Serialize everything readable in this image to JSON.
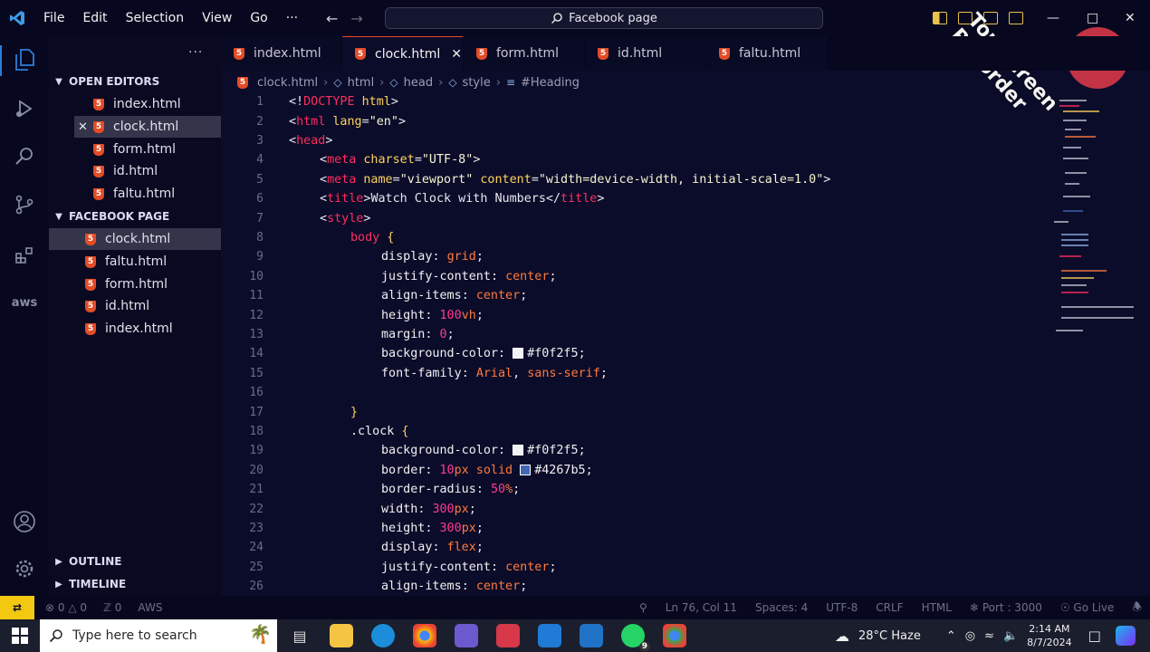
{
  "titlebar": {
    "menu": [
      "File",
      "Edit",
      "Selection",
      "View",
      "Go",
      "···"
    ],
    "search_text": "Facebook page"
  },
  "watermark": {
    "text": "Top Screen Recorder"
  },
  "sidebar": {
    "more": "···",
    "open_editors_header": "OPEN EDITORS",
    "open_editors": [
      "index.html",
      "clock.html",
      "form.html",
      "id.html",
      "faltu.html"
    ],
    "folder_header": "FACEBOOK PAGE",
    "folder_files": [
      "clock.html",
      "faltu.html",
      "form.html",
      "id.html",
      "index.html"
    ],
    "outline_header": "OUTLINE",
    "timeline_header": "TIMELINE"
  },
  "tabs": [
    {
      "label": "index.html",
      "active": false
    },
    {
      "label": "clock.html",
      "active": true
    },
    {
      "label": "form.html",
      "active": false
    },
    {
      "label": "id.html",
      "active": false
    },
    {
      "label": "faltu.html",
      "active": false
    }
  ],
  "breadcrumb": [
    "clock.html",
    "html",
    "head",
    "style",
    "#Heading"
  ],
  "editor": {
    "line_numbers": [
      "1",
      "2",
      "3",
      "4",
      "5",
      "6",
      "7",
      "8",
      "9",
      "10",
      "11",
      "12",
      "13",
      "14",
      "15",
      "16",
      "17",
      "18",
      "19",
      "20",
      "21",
      "22",
      "23",
      "24",
      "25",
      "26"
    ],
    "l1": {
      "a": "<!",
      "b": "DOCTYPE",
      "c": " html",
      "d": ">"
    },
    "l2": {
      "a": "<",
      "b": "html",
      "c": " lang",
      "d": "=",
      "e": "\"en\"",
      "f": ">"
    },
    "l3": {
      "a": "<",
      "b": "head",
      "c": ">"
    },
    "l4": {
      "a": "<",
      "b": "meta",
      "c": " charset",
      "d": "=",
      "e": "\"UTF-8\"",
      "f": ">"
    },
    "l5": {
      "a": "<",
      "b": "meta",
      "c": " name",
      "d": "=",
      "e": "\"viewport\"",
      "f": " content",
      "g": "=",
      "h": "\"width=device-width, initial-scale=1.0\"",
      "i": ">"
    },
    "l6": {
      "a": "<",
      "b": "title",
      "c": ">",
      "d": "Watch Clock with Numbers",
      "e": "</",
      "f": "title",
      "g": ">"
    },
    "l7": {
      "a": "<",
      "b": "style",
      "c": ">"
    },
    "l8": {
      "a": "body",
      "b": " {"
    },
    "l9": {
      "a": "display",
      "b": ": ",
      "c": "grid",
      "d": ";"
    },
    "l10": {
      "a": "justify-content",
      "b": ": ",
      "c": "center",
      "d": ";"
    },
    "l11": {
      "a": "align-items",
      "b": ": ",
      "c": "center",
      "d": ";"
    },
    "l12": {
      "a": "height",
      "b": ": ",
      "c": "100",
      "d": "vh",
      "e": ";"
    },
    "l13": {
      "a": "margin",
      "b": ": ",
      "c": "0",
      "d": ";"
    },
    "l14": {
      "a": "background-color",
      "b": ": ",
      "c": "#f0f2f5",
      "d": ";"
    },
    "l15": {
      "a": "font-family",
      "b": ": ",
      "c": "Arial",
      "d": ", ",
      "e": "sans-serif",
      "f": ";"
    },
    "l17": {
      "a": "}"
    },
    "l18": {
      "a": ".clock",
      "b": " {"
    },
    "l19": {
      "a": "background-color",
      "b": ": ",
      "c": "#f0f2f5",
      "d": ";"
    },
    "l20": {
      "a": "border",
      "b": ": ",
      "c": "10",
      "d": "px",
      "e": " solid ",
      "f": "#4267b5",
      "g": ";"
    },
    "l21": {
      "a": "border-radius",
      "b": ": ",
      "c": "50",
      "d": "%",
      "e": ";"
    },
    "l22": {
      "a": "width",
      "b": ": ",
      "c": "300",
      "d": "px",
      "e": ";"
    },
    "l23": {
      "a": "height",
      "b": ": ",
      "c": "300",
      "d": "px",
      "e": ";"
    },
    "l24": {
      "a": "display",
      "b": ": ",
      "c": "flex",
      "d": ";"
    },
    "l25": {
      "a": "justify-content",
      "b": ": ",
      "c": "center",
      "d": ";"
    },
    "l26": {
      "a": "align-items",
      "b": ": ",
      "c": "center",
      "d": ";"
    },
    "swatch_colors": {
      "light": "#f0f2f5",
      "blue": "#4267b5"
    }
  },
  "statusbar": {
    "errors": "0",
    "warnings": "0",
    "ports": "0",
    "aws": "AWS",
    "position": "Ln 76, Col 11",
    "spaces": "Spaces: 4",
    "encoding": "UTF-8",
    "eol": "CRLF",
    "language": "HTML",
    "port": "Port : 3000",
    "golive": "Go Live"
  },
  "taskbar": {
    "search_placeholder": "Type here to search",
    "weather": "28°C  Haze",
    "time": "2:14 AM",
    "date": "8/7/2024",
    "whatsapp_badge": "9"
  },
  "colors": {
    "accent": "#2c7fd9",
    "html_icon": "#e34c26",
    "editor_bg": "#0b0c2a",
    "remote_badge": "#f2c811"
  }
}
